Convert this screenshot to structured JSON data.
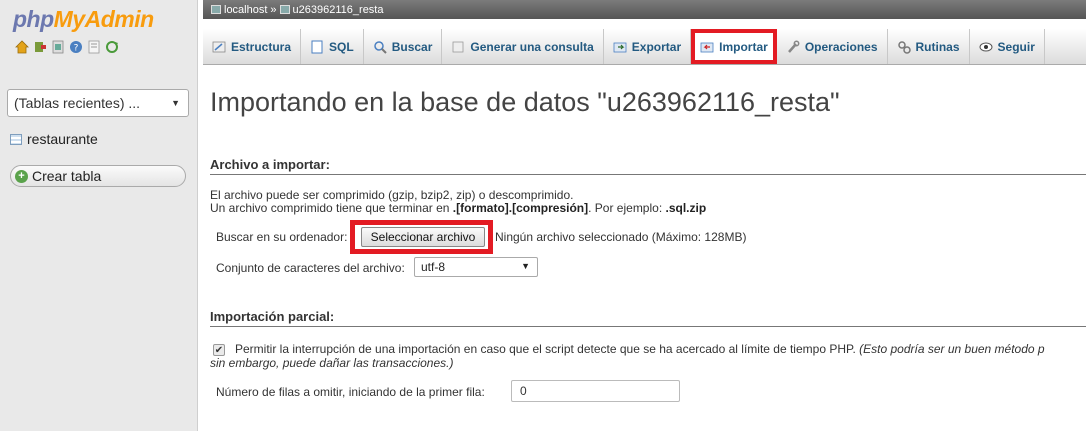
{
  "app": {
    "logo_part1": "php",
    "logo_part2": "MyAdmin"
  },
  "nav": {
    "icons": [
      "home-icon",
      "exit-icon",
      "sql-query-icon",
      "help-icon",
      "docs-icon",
      "reload-icon"
    ],
    "recent_tables": "(Tablas recientes) ...",
    "database_item": "restaurante",
    "create_table": "Crear tabla"
  },
  "breadcrumb": {
    "server": "localhost",
    "separator": "»",
    "database": "u263962116_resta"
  },
  "tabs": [
    {
      "label": "Estructura",
      "icon": "structure-icon",
      "active": false
    },
    {
      "label": "SQL",
      "icon": "sql-icon",
      "active": false
    },
    {
      "label": "Buscar",
      "icon": "search-icon",
      "active": false
    },
    {
      "label": "Generar una consulta",
      "icon": "query-icon",
      "active": false
    },
    {
      "label": "Exportar",
      "icon": "export-icon",
      "active": false
    },
    {
      "label": "Importar",
      "icon": "import-icon",
      "active": true
    },
    {
      "label": "Operaciones",
      "icon": "wrench-icon",
      "active": false
    },
    {
      "label": "Rutinas",
      "icon": "routines-icon",
      "active": false
    },
    {
      "label": "Seguir",
      "icon": "eye-icon",
      "active": false
    }
  ],
  "main": {
    "title": "Importando en la base de datos \"u263962116_resta\"",
    "file_section": {
      "legend": "Archivo a importar:",
      "line1": "El archivo puede ser comprimido (gzip, bzip2, zip) o descomprimido.",
      "line2_prefix": "Un archivo comprimido tiene que terminar en ",
      "line2_format": ".[formato].[compresión]",
      "line2_mid": ". Por ejemplo: ",
      "line2_example": ".sql.zip",
      "browse_label": "Buscar en su ordenador:",
      "browse_button": "Seleccionar archivo",
      "no_file": "Ningún archivo seleccionado (Máximo: 128MB)",
      "charset_label": "Conjunto de caracteres del archivo:",
      "charset_value": "utf-8"
    },
    "partial_section": {
      "legend": "Importación parcial:",
      "interrupt_text": "Permitir la interrupción de una importación en caso que el script detecte que se ha acercado al límite de tiempo PHP.",
      "interrupt_note1": "(Esto podría ser un buen método p",
      "interrupt_note2": "sin embargo, puede dañar las transacciones.)",
      "interrupt_checked": true,
      "skip_label": "Número de filas a omitir, iniciando de la primer fila:",
      "skip_value": "0"
    }
  },
  "colors": {
    "highlight": "#e31b23",
    "link": "#235a81",
    "logo_blue": "#6c78af",
    "logo_orange": "#f89c0e"
  }
}
